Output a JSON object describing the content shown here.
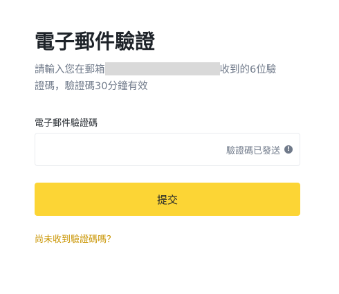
{
  "title": "電子郵件驗證",
  "description": {
    "line1_prefix": "請輸入您在郵箱",
    "line1_suffix": "收到的6位驗",
    "line2": "證碼，驗證碼30分鐘有效"
  },
  "code_field": {
    "label": "電子郵件驗證碼",
    "value": "",
    "status_text": "驗證碼已發送",
    "status_icon": "info-icon"
  },
  "submit_label": "提交",
  "resend_link": "尚未收到驗證碼嗎？",
  "colors": {
    "accent": "#fcd535",
    "link": "#c99400",
    "text": "#1e2329",
    "muted": "#707a8a"
  }
}
